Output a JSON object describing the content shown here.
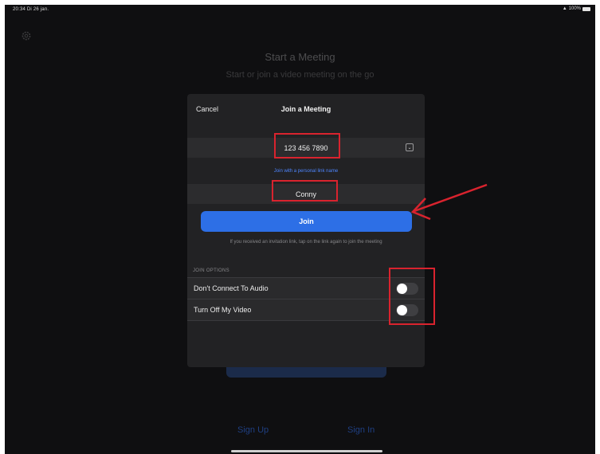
{
  "status_bar": {
    "time": "20:34  Di 26 jan.",
    "battery": "100%"
  },
  "background": {
    "title": "Start a Meeting",
    "subtitle": "Start or join a video meeting on the go",
    "sign_up": "Sign Up",
    "sign_in": "Sign In"
  },
  "modal": {
    "cancel": "Cancel",
    "title": "Join a Meeting",
    "meeting_id": "123 456 7890",
    "personal_link": "Join with a personal link name",
    "name": "Conny",
    "join_button": "Join",
    "hint": "If you received an invitation link, tap on the link again to join the meeting",
    "options_header": "JOIN OPTIONS",
    "options": [
      {
        "label": "Don't Connect To Audio",
        "on": false
      },
      {
        "label": "Turn Off My Video",
        "on": false
      }
    ]
  },
  "colors": {
    "accent": "#2d6fe6",
    "highlight": "#d9232e"
  }
}
